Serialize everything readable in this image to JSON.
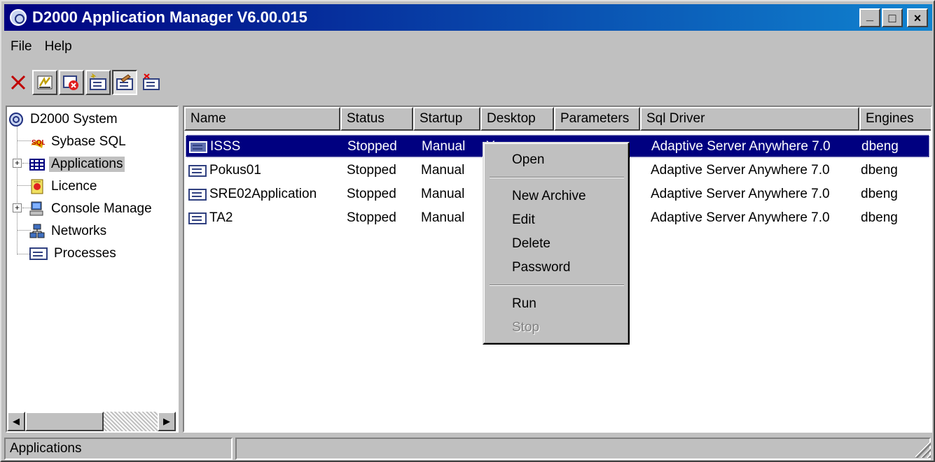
{
  "window": {
    "title": "D2000 Application Manager V6.00.015",
    "buttons": {
      "minimize": "_",
      "maximize": "□",
      "close": "×"
    }
  },
  "menubar": {
    "items": [
      "File",
      "Help"
    ]
  },
  "toolbar": {
    "buttons": [
      {
        "icon": "delete-x-icon"
      },
      {
        "icon": "edit-application-icon"
      },
      {
        "icon": "stop-application-icon"
      },
      {
        "icon": "new-process-icon"
      },
      {
        "icon": "properties-icon",
        "pressed": true
      },
      {
        "icon": "delete-process-icon"
      }
    ]
  },
  "tree": {
    "root": "D2000 System",
    "items": [
      {
        "label": "Sybase SQL",
        "icon": "sql-icon"
      },
      {
        "label": "Applications",
        "icon": "applications-grid-icon",
        "selected": true,
        "expandable": true
      },
      {
        "label": "Licence",
        "icon": "licence-certificate-icon"
      },
      {
        "label": "Console Manage",
        "icon": "console-computer-icon",
        "expandable": true
      },
      {
        "label": "Networks",
        "icon": "network-icon"
      },
      {
        "label": "Processes",
        "icon": "process-icon"
      }
    ]
  },
  "listview": {
    "columns": [
      "Name",
      "Status",
      "Startup",
      "Desktop",
      "Parameters",
      "Sql Driver",
      "Engines"
    ],
    "rows": [
      {
        "name": "ISSS",
        "status": "Stopped",
        "startup": "Manual",
        "desktop": "Y",
        "parameters": "",
        "sql_driver": "Adaptive Server Anywhere 7.0",
        "engines": "dbeng",
        "selected": true
      },
      {
        "name": "Pokus01",
        "status": "Stopped",
        "startup": "Manual",
        "desktop": "",
        "parameters": "",
        "sql_driver": "Adaptive Server Anywhere 7.0",
        "engines": "dbeng"
      },
      {
        "name": "SRE02Application",
        "status": "Stopped",
        "startup": "Manual",
        "desktop": "",
        "parameters": "",
        "sql_driver": "Adaptive Server Anywhere 7.0",
        "engines": "dbeng"
      },
      {
        "name": "TA2",
        "status": "Stopped",
        "startup": "Manual",
        "desktop": "",
        "parameters": "",
        "sql_driver": "Adaptive Server Anywhere 7.0",
        "engines": "dbeng"
      }
    ]
  },
  "context_menu": {
    "items": [
      {
        "label": "Open",
        "enabled": true
      },
      {
        "label": "New Archive",
        "enabled": true
      },
      {
        "label": "Edit",
        "enabled": true
      },
      {
        "label": "Delete",
        "enabled": true
      },
      {
        "label": "Password",
        "enabled": true
      },
      {
        "label": "Run",
        "enabled": true
      },
      {
        "label": "Stop",
        "enabled": false
      }
    ]
  },
  "statusbar": {
    "text": "Applications",
    "second": ""
  },
  "colors": {
    "title_start": "#000080",
    "title_end": "#1084d0",
    "selection": "#000080",
    "face": "#c0c0c0"
  }
}
